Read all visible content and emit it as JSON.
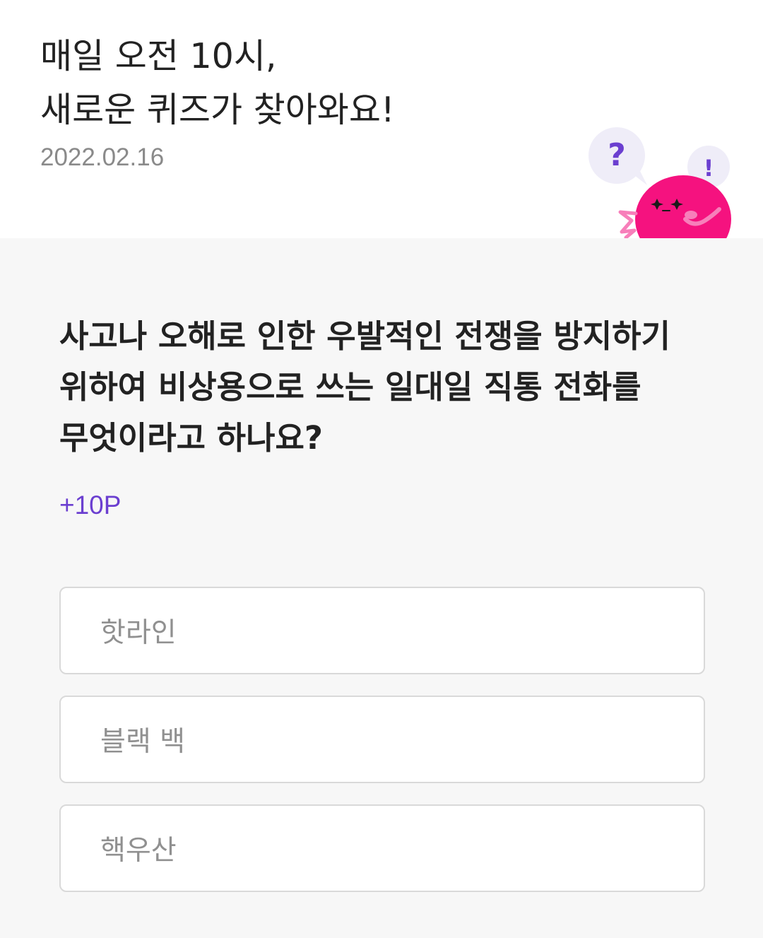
{
  "header": {
    "title_line1": "매일 오전 10시,",
    "title_line2": "새로운 퀴즈가 찾아와요!",
    "date": "2022.02.16",
    "mascot": {
      "question_mark": "?",
      "exclamation_mark": "!",
      "body_color": "#f5127f",
      "bubble_color": "#efedf8",
      "accent_color": "#6b3fd0"
    }
  },
  "quiz": {
    "question_lines": [
      "사고나 오해로 인한 우발적인 전쟁을 방지하기",
      "위하여 비상용으로 쓰는 일대일 직통 전화를",
      "무엇이라고 하나요?"
    ],
    "points": "+10P",
    "options": [
      {
        "label": "핫라인"
      },
      {
        "label": "블랙 백"
      },
      {
        "label": "핵우산"
      }
    ]
  },
  "colors": {
    "background": "#f7f7f7",
    "header_background": "#ffffff",
    "accent": "#6b3fd0",
    "option_text": "#909090",
    "option_border": "#d9d9d9"
  }
}
